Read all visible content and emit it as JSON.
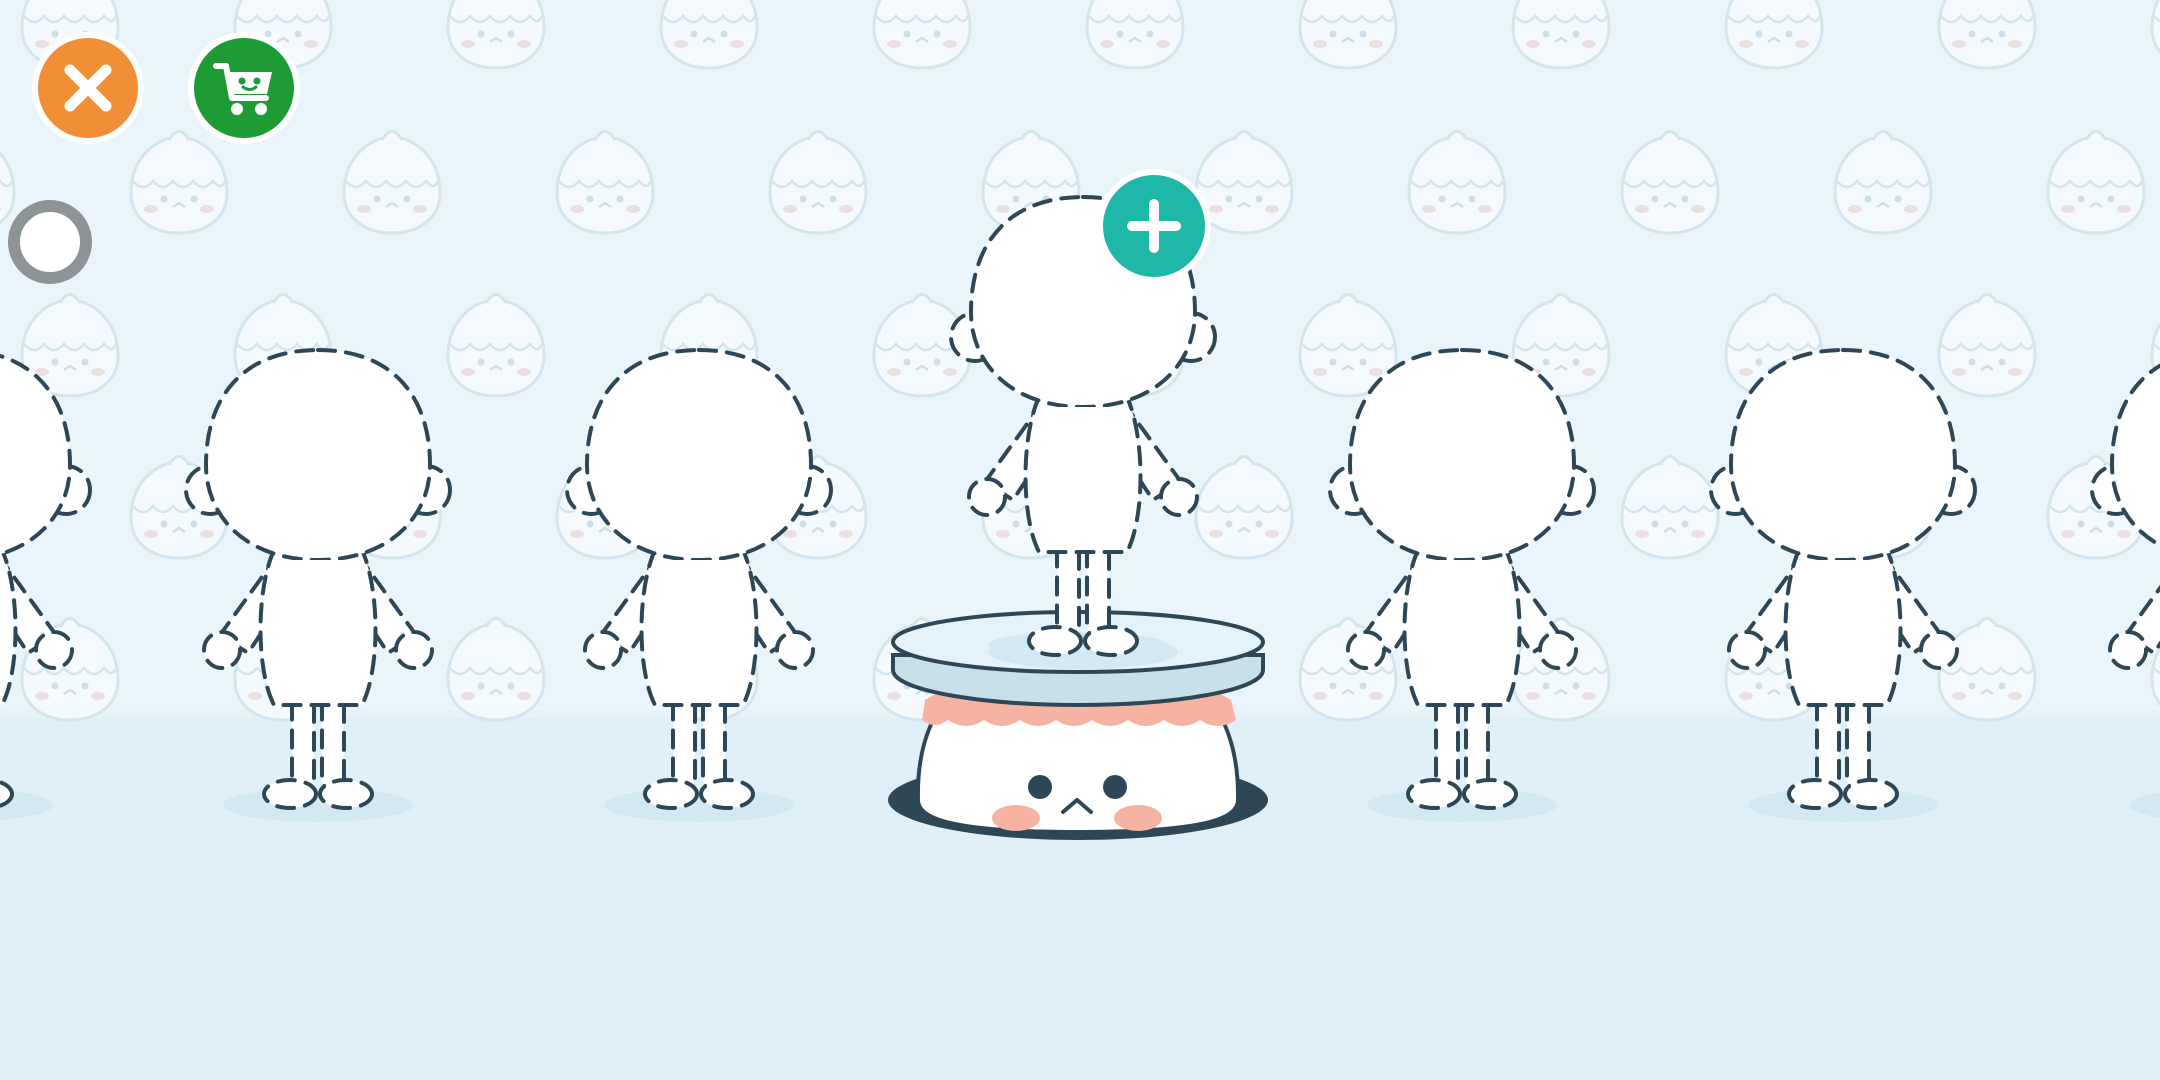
{
  "app": {
    "screen": "character-select"
  },
  "colors": {
    "wall": "#eaf5fb",
    "floor": "#dff0f8",
    "bg_pattern": "#dfeef6",
    "outline": "#2e4757",
    "close_button": "#f28e35",
    "shop_button": "#1d9b34",
    "add_button": "#1fb7a8",
    "toggle_ring": "#8e9396",
    "pedestal_blush": "#f6b3a2"
  },
  "controls": {
    "close": {
      "icon": "close-icon"
    },
    "shop": {
      "icon": "shopping-cart-icon"
    },
    "toggle": {
      "icon": "toggle-ring-icon"
    },
    "add": {
      "icon": "plus-icon"
    }
  },
  "characters": [
    {
      "slot": 1,
      "state": "empty"
    },
    {
      "slot": 2,
      "state": "empty"
    },
    {
      "slot": 3,
      "state": "empty"
    },
    {
      "slot": 4,
      "state": "empty",
      "selected": true
    },
    {
      "slot": 5,
      "state": "empty"
    },
    {
      "slot": 6,
      "state": "empty"
    },
    {
      "slot": 7,
      "state": "empty"
    }
  ]
}
